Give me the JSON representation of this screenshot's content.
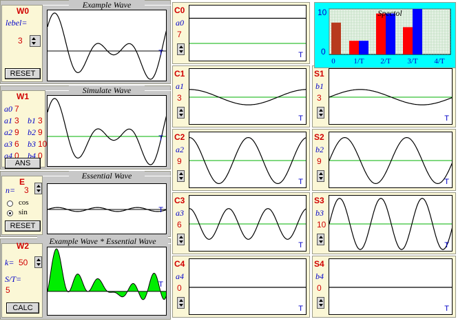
{
  "w0": {
    "header": "Example Wave",
    "title": "W0",
    "label": "lebel=",
    "value": "3",
    "reset": "RESET",
    "t": "T"
  },
  "w1": {
    "header": "Simulate Wave",
    "title": "W1",
    "rows": [
      {
        "a": "a0",
        "av": "7",
        "b": "",
        "bv": ""
      },
      {
        "a": "a1",
        "av": "3",
        "b": "b1",
        "bv": "3"
      },
      {
        "a": "a2",
        "av": "9",
        "b": "b2",
        "bv": "9"
      },
      {
        "a": "a3",
        "av": "6",
        "b": "b3",
        "bv": "10"
      },
      {
        "a": "a4",
        "av": "0",
        "b": "b4",
        "bv": "0"
      }
    ],
    "ans": "ANS",
    "t": "T"
  },
  "e": {
    "header": "Essential Wave",
    "title": "E",
    "n_label": "n=",
    "n_value": "3",
    "cos": "cos",
    "sin": "sin",
    "selected": "sin",
    "reset": "RESET",
    "t": "T"
  },
  "w2": {
    "header": "Example Wave * Essential Wave",
    "title": "W2",
    "k_label": "k=",
    "k_value": "50",
    "st_label": "S/T=",
    "st_value": "5",
    "calc": "CALC",
    "t": "T"
  },
  "components": [
    {
      "id": "c0",
      "title": "C0",
      "coef": "a0",
      "value": "7",
      "t": "T"
    },
    {
      "id": "c1",
      "title": "C1",
      "coef": "a1",
      "value": "3",
      "t": "T"
    },
    {
      "id": "s1",
      "title": "S1",
      "coef": "b1",
      "value": "3",
      "t": "T"
    },
    {
      "id": "c2",
      "title": "C2",
      "coef": "a2",
      "value": "9",
      "t": "T"
    },
    {
      "id": "s2",
      "title": "S2",
      "coef": "b2",
      "value": "9",
      "t": "T"
    },
    {
      "id": "c3",
      "title": "C3",
      "coef": "a3",
      "value": "6",
      "t": "T"
    },
    {
      "id": "s3",
      "title": "S3",
      "coef": "b3",
      "value": "10",
      "t": "T"
    },
    {
      "id": "c4",
      "title": "C4",
      "coef": "a4",
      "value": "0",
      "t": "T"
    },
    {
      "id": "s4",
      "title": "S4",
      "coef": "b4",
      "value": "0",
      "t": "T"
    }
  ],
  "colors": {
    "cos_bar": "#ff0000",
    "sin_bar": "#0000ff",
    "first_bar": "#b83a1e",
    "axis_line": "#00b000",
    "spectrum_bg": "#00ffff",
    "fill": "#00ee00"
  },
  "chart_data": {
    "type": "bar",
    "title": "Spectol",
    "categories": [
      "0",
      "1/T",
      "2/T",
      "3/T",
      "4/T"
    ],
    "y_ticks": [
      "10",
      "0"
    ],
    "ylim": [
      0,
      10
    ],
    "series": [
      {
        "values": [
          7,
          3,
          9,
          6,
          0
        ]
      },
      {
        "values": [
          null,
          3,
          9,
          10,
          0
        ]
      }
    ]
  }
}
